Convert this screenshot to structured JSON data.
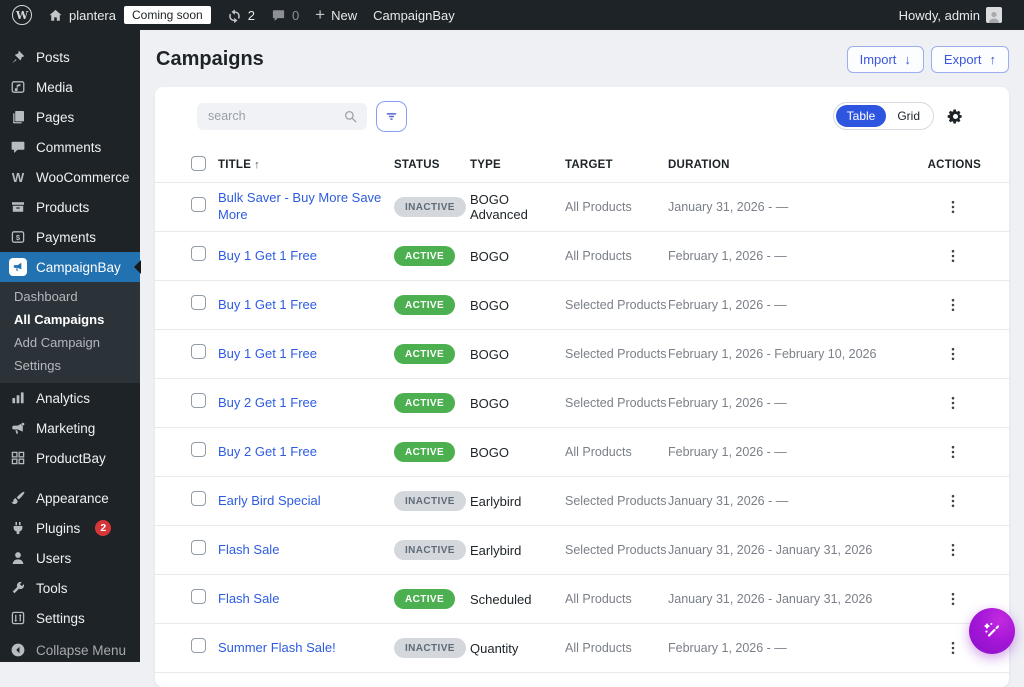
{
  "admin_bar": {
    "site_name": "plantera",
    "coming_soon": "Coming soon",
    "updates_count": "2",
    "comments_count": "0",
    "new_label": "New",
    "menu_label": "CampaignBay",
    "howdy": "Howdy, admin"
  },
  "sidebar": {
    "posts": "Posts",
    "media": "Media",
    "pages": "Pages",
    "comments": "Comments",
    "woocommerce": "WooCommerce",
    "products": "Products",
    "payments": "Payments",
    "campaignbay": "CampaignBay",
    "submenu": {
      "dashboard": "Dashboard",
      "all_campaigns": "All Campaigns",
      "add_campaign": "Add Campaign",
      "settings": "Settings"
    },
    "analytics": "Analytics",
    "marketing": "Marketing",
    "productbay": "ProductBay",
    "appearance": "Appearance",
    "plugins": "Plugins",
    "plugins_badge": "2",
    "users": "Users",
    "tools": "Tools",
    "settings": "Settings",
    "collapse": "Collapse Menu"
  },
  "page": {
    "title": "Campaigns",
    "import_label": "Import",
    "import_arrow": "↓",
    "export_label": "Export",
    "export_arrow": "↑",
    "search_placeholder": "search",
    "view_toggle": {
      "table": "Table",
      "grid": "Grid"
    }
  },
  "table": {
    "headers": {
      "title": "TITLE",
      "sort_arrow": "↑",
      "status": "STATUS",
      "type": "TYPE",
      "target": "TARGET",
      "duration": "DURATION",
      "actions": "ACTIONS"
    },
    "rows": [
      {
        "title": "Bulk Saver - Buy More Save More",
        "status": "INACTIVE",
        "type": "BOGO Advanced",
        "target": "All Products",
        "duration": "January 31, 2026 - —"
      },
      {
        "title": "Buy 1 Get 1 Free",
        "status": "ACTIVE",
        "type": "BOGO",
        "target": "All Products",
        "duration": "February 1, 2026 - —"
      },
      {
        "title": "Buy 1 Get 1 Free",
        "status": "ACTIVE",
        "type": "BOGO",
        "target": "Selected Products",
        "duration": "February 1, 2026 - —"
      },
      {
        "title": "Buy 1 Get 1 Free",
        "status": "ACTIVE",
        "type": "BOGO",
        "target": "Selected Products",
        "duration": "February 1, 2026 - February 10, 2026"
      },
      {
        "title": "Buy 2 Get 1 Free",
        "status": "ACTIVE",
        "type": "BOGO",
        "target": "Selected Products",
        "duration": "February 1, 2026 - —"
      },
      {
        "title": "Buy 2 Get 1 Free",
        "status": "ACTIVE",
        "type": "BOGO",
        "target": "All Products",
        "duration": "February 1, 2026 - —"
      },
      {
        "title": "Early Bird Special",
        "status": "INACTIVE",
        "type": "Earlybird",
        "target": "Selected Products",
        "duration": "January 31, 2026 - —"
      },
      {
        "title": "Flash Sale",
        "status": "INACTIVE",
        "type": "Earlybird",
        "target": "Selected Products",
        "duration": "January 31, 2026 - January 31, 2026"
      },
      {
        "title": "Flash Sale",
        "status": "ACTIVE",
        "type": "Scheduled",
        "target": "All Products",
        "duration": "January 31, 2026 - January 31, 2026"
      },
      {
        "title": "Summer Flash Sale!",
        "status": "INACTIVE",
        "type": "Quantity",
        "target": "All Products",
        "duration": "February 1, 2026 - —"
      }
    ]
  },
  "colors": {
    "wp_admin_blue": "#2271b1",
    "accent_blue": "#2e55e0",
    "link_blue": "#2d5ce0",
    "active_green": "#4caf50",
    "inactive_gray": "#d4d8dd",
    "plugins_badge_red": "#d63638",
    "fab_purple": "#a316d6"
  }
}
